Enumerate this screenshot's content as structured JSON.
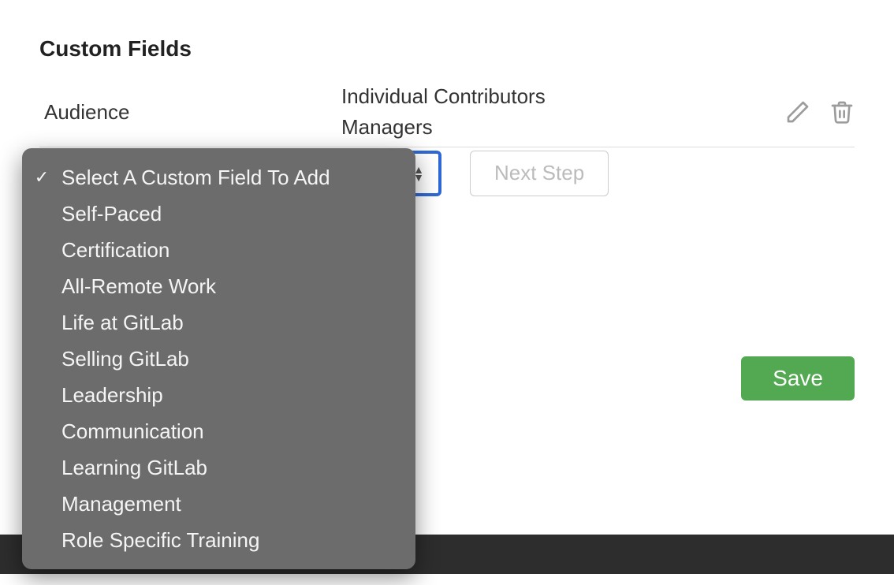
{
  "section_title": "Custom Fields",
  "field": {
    "label": "Audience",
    "values": [
      "Individual Contributors",
      "Managers"
    ]
  },
  "select": {
    "placeholder": "Select A Custom Field To Add",
    "options": [
      "Select A Custom Field To Add",
      "Self-Paced",
      "Certification",
      "All-Remote Work",
      "Life at GitLab",
      "Selling GitLab",
      "Leadership",
      "Communication",
      "Learning GitLab",
      "Management",
      "Role Specific Training"
    ],
    "selected_index": 0
  },
  "buttons": {
    "next_step": "Next Step",
    "save": "Save"
  },
  "icons": {
    "edit": "edit-icon",
    "delete": "trash-icon"
  },
  "colors": {
    "primary_green": "#53a852",
    "focus_blue": "#2f68d6",
    "dropdown_bg": "#6c6c6c"
  }
}
